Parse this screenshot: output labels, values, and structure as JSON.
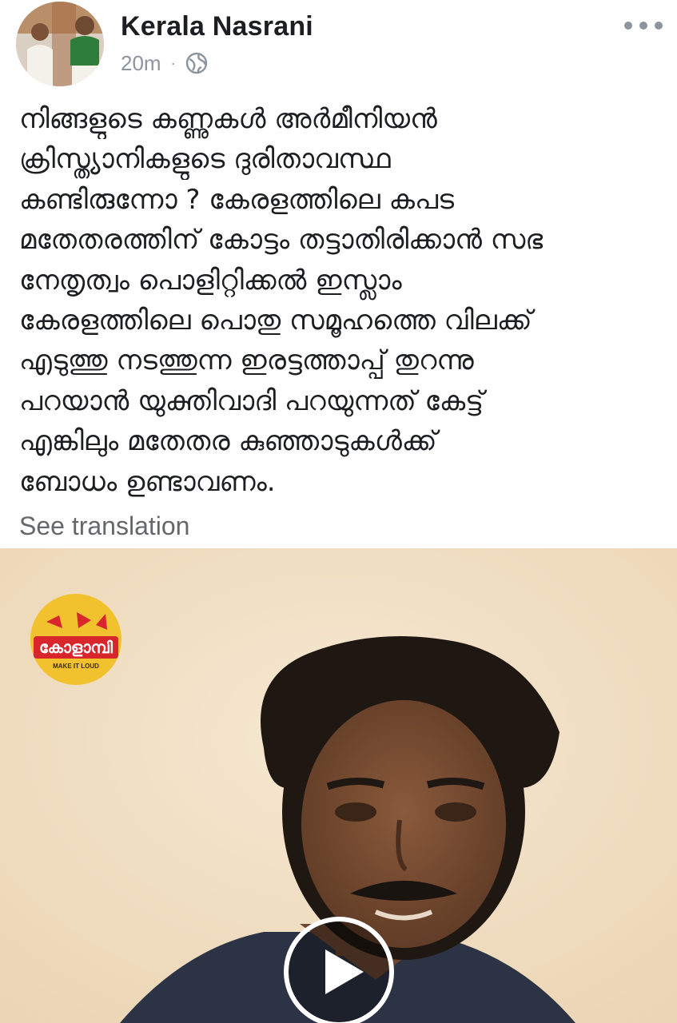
{
  "header": {
    "author_name": "Kerala Nasrani",
    "timestamp": "20m",
    "separator": "·",
    "audience_icon": "globe-icon",
    "more_icon": "more-horizontal-icon"
  },
  "post": {
    "lines": [
      "നിങ്ങളുടെ കണ്ണുകൾ അർമീനിയൻ",
      "ക്രിസ്ത്യാനികളുടെ ദുരിതാവസ്ഥ",
      "കണ്ടിരുന്നോ ?  കേരളത്തിലെ കപട",
      "മതേതരത്തിന് കോട്ടം തട്ടാതിരിക്കാൻ സഭ",
      "നേതൃത്വം   പൊളിറ്റിക്കൽ ഇസ്ലാം",
      "കേരളത്തിലെ  പൊതു സമൂഹത്തെ വിലക്ക്",
      "എടുത്തു നടത്തുന്ന ഇരട്ടത്താപ്പ്  തുറന്നു",
      "പറയാൻ  യുക്തിവാദി പറയുന്നത് കേട്ട്",
      "എങ്കിലും മതേതര കുഞ്ഞാടുകൾക്ക്",
      "ബോധം ഉണ്ടാവണം."
    ],
    "see_translation": "See translation"
  },
  "video": {
    "logo_text": "കോളാമ്പി",
    "logo_tagline": "MAKE IT LOUD",
    "play_icon": "play-icon",
    "colors": {
      "background": "#f3e3ca",
      "logo_yellow": "#f2c12e",
      "logo_red": "#d8262c"
    }
  },
  "colors": {
    "text": "#1c1e21",
    "secondary": "#8d949e",
    "link_gray": "#65676b"
  }
}
